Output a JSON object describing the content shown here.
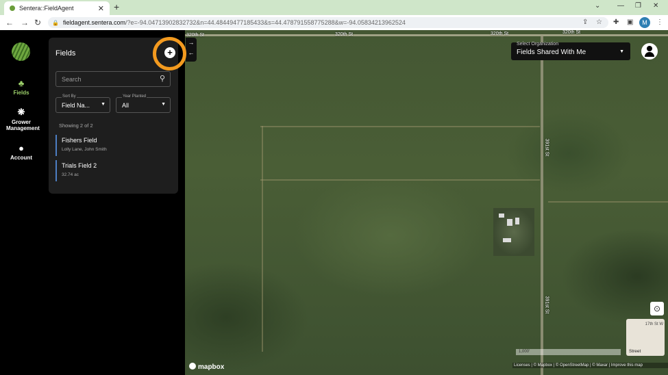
{
  "browser": {
    "tab_title": "Sentera::FieldAgent",
    "tab_close": "✕",
    "new_tab": "+",
    "url_host": "fieldagent.sentera.com",
    "url_rest": "/?e=-94.04713902832732&n=44.48449477185433&s=44.478791558775288&w=-94.05834213962524",
    "profile_initial": "M"
  },
  "leftnav": {
    "items": [
      {
        "label": "Fields",
        "icon": "seedling-icon"
      },
      {
        "label": "Grower Management",
        "icon": "paw-icon"
      },
      {
        "label": "Account",
        "icon": "account-icon"
      }
    ]
  },
  "fields_panel": {
    "title": "Fields",
    "search_placeholder": "Search",
    "sort_by_label": "Sort By",
    "sort_by_value": "Field Na...",
    "year_label": "Year Planted",
    "year_value": "All",
    "count_text": "Showing 2 of 2",
    "fields": [
      {
        "name": "Fishers Field",
        "sub": "Lolly Lane, John Smith"
      },
      {
        "name": "Trials Field 2",
        "sub": "32.74 ac"
      }
    ]
  },
  "map": {
    "road_labels": [
      "320th St",
      "320th St",
      "320th St",
      "320th St",
      "391st St",
      "391st St"
    ],
    "org_label": "Select Organization",
    "org_value": "Fields Shared With Me",
    "minimap_label": "Street",
    "minimap_street": "17th St W",
    "scale_text": "1,000'",
    "attribution": "Licenses | © Mapbox | © OpenStreetMap | © Maxar | Improve this map",
    "brand": "mapbox"
  },
  "colors": {
    "accent_orange": "#f39a1f",
    "active_nav": "#9ccf6a",
    "list_accent": "#4d7fc4"
  }
}
